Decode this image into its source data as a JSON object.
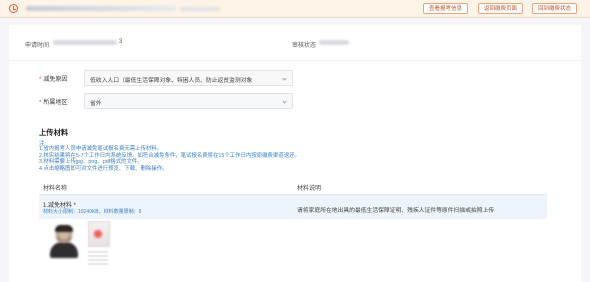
{
  "topbar": {
    "buttons": [
      "查看报考信息",
      "返回缴费页面",
      "回到缴费状态"
    ]
  },
  "info": {
    "apply_time_label": "申请时间",
    "apply_time_tail": "3",
    "review_status_label": "审核状态"
  },
  "form": {
    "reason_label": "减免原因",
    "reason_value": "低收入人口（最低生活保障对象、特困人员、防止返贫监测对象",
    "region_label": "所属地区",
    "region_value": "省外"
  },
  "upload": {
    "title": "上传材料",
    "note_head": "注:",
    "notes": [
      "1.省内报考人员申请减免笔试报名费无需上传材料。",
      "2.核实结果将在5-7个工作日内系统反馈。如符合减免条件，笔试报名费将在15个工作日内按原缴费渠道退还。",
      "3.材料需要上传jpg、png、pdf格式的文件。",
      "4.点击缩略图即可对文件进行预览、下载、删除操作。"
    ],
    "table": {
      "col_name": "材料名称",
      "col_desc": "材料说明",
      "rows": [
        {
          "name": "1.减免材料 *",
          "sub": "材料大小限制：10240KB，材料数量限制：5",
          "desc": "请将家庭所在地出具的最低生活保障证明、残疾人证件等原件扫描或拍照上传"
        }
      ]
    }
  },
  "icons": {
    "clock": "clock-icon",
    "chevron": "chevron-down-icon"
  },
  "colors": {
    "accent": "#c0572c",
    "link_blue": "#3b7fc4",
    "required": "#e4393c"
  }
}
